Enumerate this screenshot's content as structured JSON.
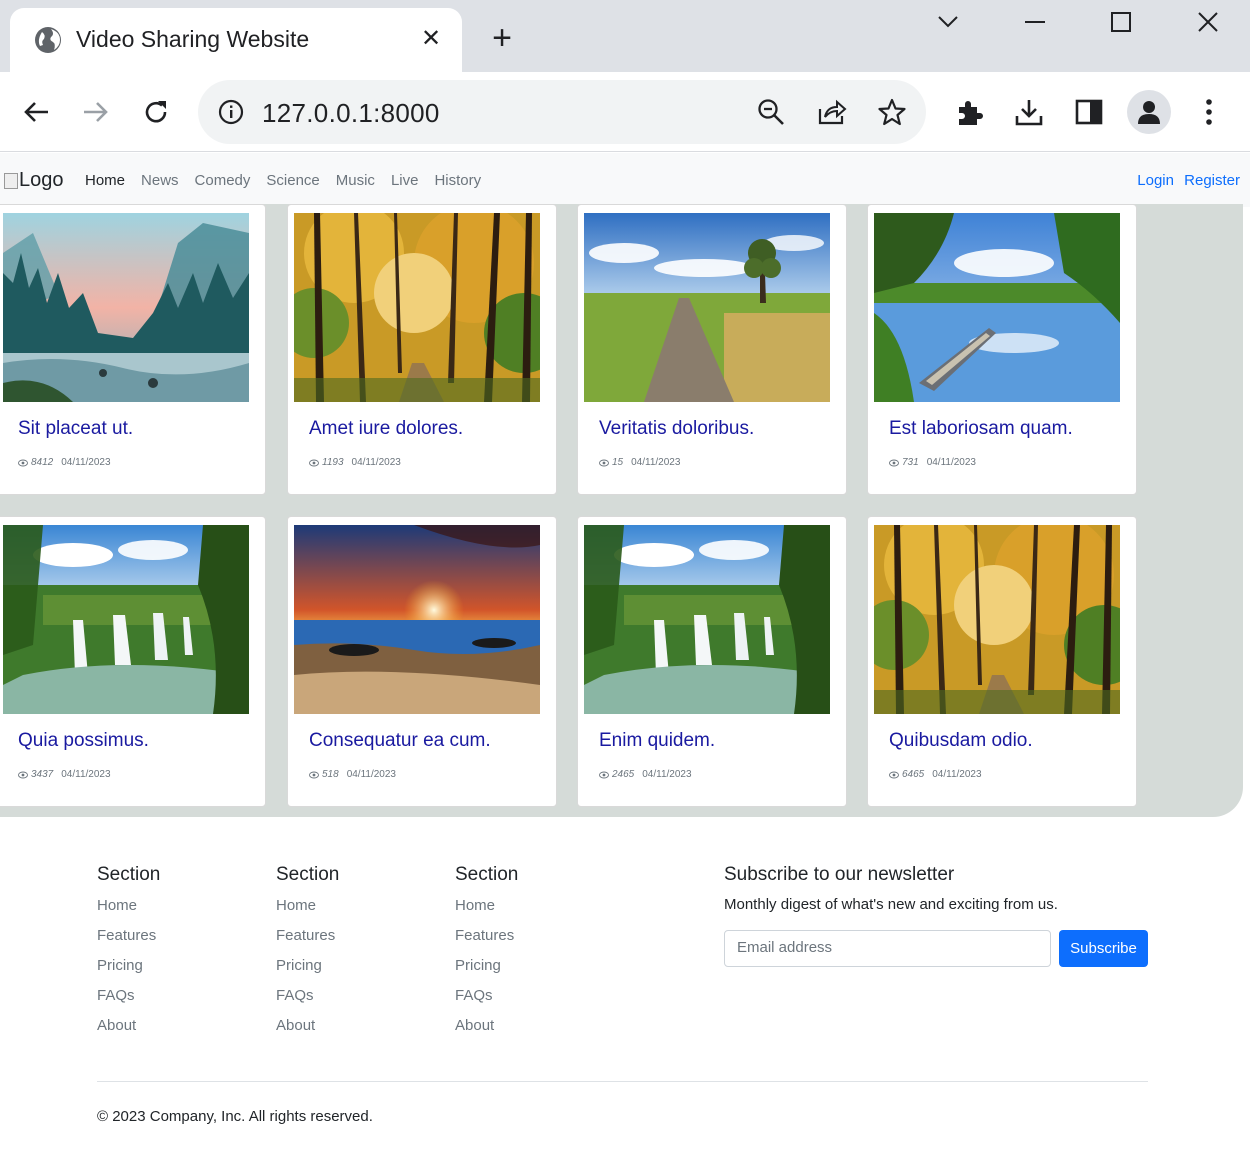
{
  "browser": {
    "tab_title": "Video Sharing Website",
    "url": "127.0.0.1:8000"
  },
  "site": {
    "logo_alt": "Logo",
    "nav": [
      "Home",
      "News",
      "Comedy",
      "Science",
      "Music",
      "Live",
      "History"
    ],
    "active_nav": "Home",
    "login": "Login",
    "register": "Register"
  },
  "videos": [
    {
      "title": "Sit placeat ut.",
      "views": "8412",
      "date": "04/11/2023",
      "scene": "mountain-lake"
    },
    {
      "title": "Amet iure dolores.",
      "views": "1193",
      "date": "04/11/2023",
      "scene": "autumn-forest"
    },
    {
      "title": "Veritatis doloribus.",
      "views": "15",
      "date": "04/11/2023",
      "scene": "country-road"
    },
    {
      "title": "Est laboriosam quam.",
      "views": "731",
      "date": "04/11/2023",
      "scene": "lake-boat"
    },
    {
      "title": "Quia possimus.",
      "views": "3437",
      "date": "04/11/2023",
      "scene": "waterfalls"
    },
    {
      "title": "Consequatur ea cum.",
      "views": "518",
      "date": "04/11/2023",
      "scene": "ocean-sunset"
    },
    {
      "title": "Enim quidem.",
      "views": "2465",
      "date": "04/11/2023",
      "scene": "waterfalls"
    },
    {
      "title": "Quibusdam odio.",
      "views": "6465",
      "date": "04/11/2023",
      "scene": "autumn-forest"
    }
  ],
  "footer": {
    "columns": [
      {
        "heading": "Section",
        "links": [
          "Home",
          "Features",
          "Pricing",
          "FAQs",
          "About"
        ]
      },
      {
        "heading": "Section",
        "links": [
          "Home",
          "Features",
          "Pricing",
          "FAQs",
          "About"
        ]
      },
      {
        "heading": "Section",
        "links": [
          "Home",
          "Features",
          "Pricing",
          "FAQs",
          "About"
        ]
      }
    ],
    "newsletter": {
      "heading": "Subscribe to our newsletter",
      "text": "Monthly digest of what's new and exciting from us.",
      "placeholder": "Email address",
      "button": "Subscribe"
    },
    "copyright": "© 2023 Company, Inc. All rights reserved."
  },
  "colors": {
    "content_bg": "#d5dbd8",
    "title_link": "#1a1aa0",
    "primary": "#0d6efd"
  }
}
